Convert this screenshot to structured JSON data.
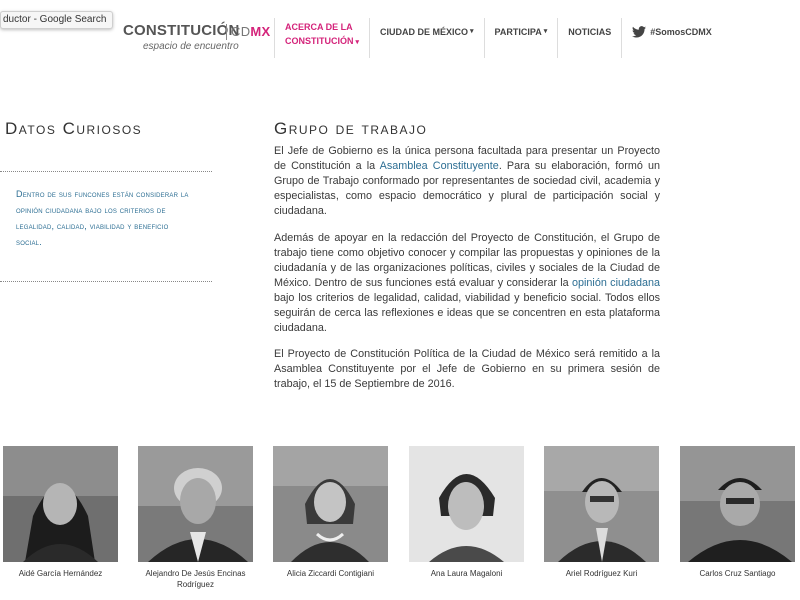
{
  "tooltip": "ductor - Google Search",
  "logo": {
    "word": "CONSTITUCIÓN",
    "cd": "CD",
    "mx": "MX",
    "tagline": "espacio de encuentro"
  },
  "nav": {
    "item1_line1": "ACERCA DE LA",
    "item1_line2": "CONSTITUCIÓN",
    "item2": "CIUDAD DE MÉXICO",
    "item3": "PARTICIPA",
    "item4": "NOTICIAS",
    "item5": "#SomosCDMX"
  },
  "sidebar": {
    "heading": "Datos Curiosos",
    "text": "Dentro de sus funcones están considerar la opinión ciudadana bajo los criterios de legalidad, calidad, viabilidad y beneficio social."
  },
  "main": {
    "heading": "Grupo de trabajo",
    "p1_a": "El Jefe de Gobierno es la única persona facultada para presentar un Proyecto de Constitución a la ",
    "p1_link": "Asamblea Constituyente",
    "p1_b": ". Para su elaboración, formó un Grupo de Trabajo conformado por representantes de sociedad civil, academia y especialistas, como espacio democrático y plural de participación social y ciudadana.",
    "p2_a": "Además de apoyar en la redacción del Proyecto de Constitución, el Grupo de trabajo tiene como objetivo conocer y compilar las propuestas y opiniones de la ciudadanía y de las organizaciones políticas, civiles y sociales de la Ciudad de México. Dentro de sus funciones está evaluar y considerar la ",
    "p2_link": "opinión ciudadana",
    "p2_b": " bajo los criterios de legalidad, calidad, viabilidad y beneficio social. Todos ellos seguirán de cerca las reflexiones e ideas que se concentren en esta plataforma ciudadana.",
    "p3": "El Proyecto de Constitución Política de la Ciudad de México será remitido a la Asamblea Constituyente por el Jefe de Gobierno en su primera sesión de trabajo, el 15 de Septiembre de 2016."
  },
  "team": [
    {
      "name": "Aidé García Hernández"
    },
    {
      "name": "Alejandro De Jesús Encinas Rodríguez"
    },
    {
      "name": "Alicia Ziccardi Contigiani"
    },
    {
      "name": "Ana Laura Magaloni"
    },
    {
      "name": "Ariel Rodríguez Kuri"
    },
    {
      "name": "Carlos Cruz Santiago"
    }
  ],
  "colors": {
    "accent": "#d4237a",
    "link": "#2c6e93"
  }
}
